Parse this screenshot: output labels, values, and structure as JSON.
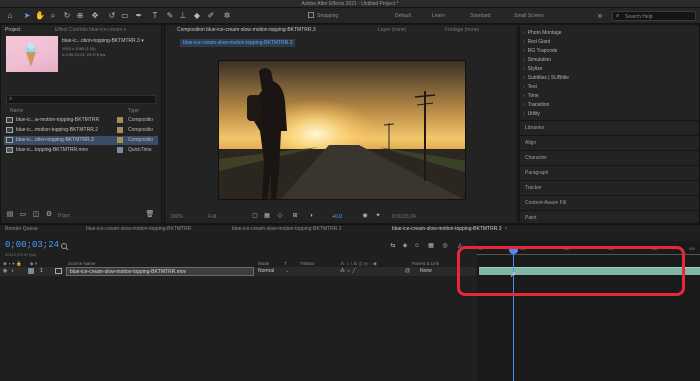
{
  "window": {
    "title": "Adobe After Effects 2021 - Untitled Project *"
  },
  "toolbar": {
    "snapping_label": "Snapping",
    "workspaces": [
      "Default",
      "Learn",
      "Standard",
      "Small Screen"
    ],
    "help_search_placeholder": "Search Help"
  },
  "project_panel": {
    "tab_project": "Project",
    "tab_effect_controls": "Effect Controls blue-ice-cream-s",
    "selected_item": {
      "name": "blue-ic...otion-topping-BKTMTRR.3 ▾",
      "dimensions": "1920 x 1080 (1.00)",
      "duration": "Δ 0;00;24;23, 23.976 fps"
    },
    "columns": {
      "name": "Name",
      "type": "Type"
    },
    "items": [
      {
        "name": "blue-ic...w-motion-topping-BKTMTRR",
        "type": "Compositio"
      },
      {
        "name": "blue-ic...motion-topping-BKTMTRR.2",
        "type": "Compositio"
      },
      {
        "name": "blue-ic...otion-topping-BKTMTRR.3",
        "type": "Compositio"
      },
      {
        "name": "blue-ic...topping-BKTMTRR.mov",
        "type": "QuickTime"
      }
    ],
    "bpc": "8 bpc"
  },
  "composition_panel": {
    "tab_label": "Composition blue-ice-cream-slow-motion-topping-BKTMTRR.3",
    "layer_tab": "Layer (none)",
    "footage_tab": "Footage (none)",
    "breadcrumb": "blue-ice-cream-slow-motion-topping-BKTMTRR.3",
    "zoom": "100%",
    "resolution": "Full",
    "exposure": "+0.0",
    "timecode": "0;00;03;24"
  },
  "right_panel": {
    "items": [
      "Photo Montage",
      "Red Giant",
      "RG Trapcode",
      "Simulation",
      "Stylize",
      "Subtitles | SUBtitle",
      "Text",
      "Time",
      "Transition",
      "Utility"
    ],
    "sections": [
      "Libraries",
      "Align",
      "Character",
      "Paragraph",
      "Tracker",
      "Content-Aware Fill",
      "Paint"
    ]
  },
  "render_queue_tab": "Render Queue",
  "timeline": {
    "tabs": [
      {
        "label": "blue-ice-cream-slow-motion-topping-BKTMTRR",
        "active": false
      },
      {
        "label": "blue-ice-cream-slow-motion-topping-BKTMTRR.2",
        "active": false
      },
      {
        "label": "blue-ice-cream-slow-motion-topping-BKTMTRR.3",
        "active": true
      }
    ],
    "current_time": "0;00;03;24",
    "current_time_sub": "00114 (29.97 fps)",
    "columns": {
      "source_name": "Source Name",
      "mode": "Mode",
      "t": "T",
      "trkmat": "TrkMat",
      "switches": "⁂ ☼ \\ fx ◫ ◎ ◌ ◉",
      "parent": "Parent & Link"
    },
    "layer": {
      "number": "1",
      "name": "blue-ice-cream-slow-motion-topping-BKTMTRR.mov",
      "mode": "Normal",
      "parent": "None"
    },
    "ruler_ticks": [
      "0f",
      "01f",
      "02f",
      "03f",
      "04f",
      "05f"
    ]
  },
  "colors": {
    "accent": "#4a9dff",
    "highlight_box": "#e8283a",
    "layer_bar": "#7fb5a5"
  }
}
